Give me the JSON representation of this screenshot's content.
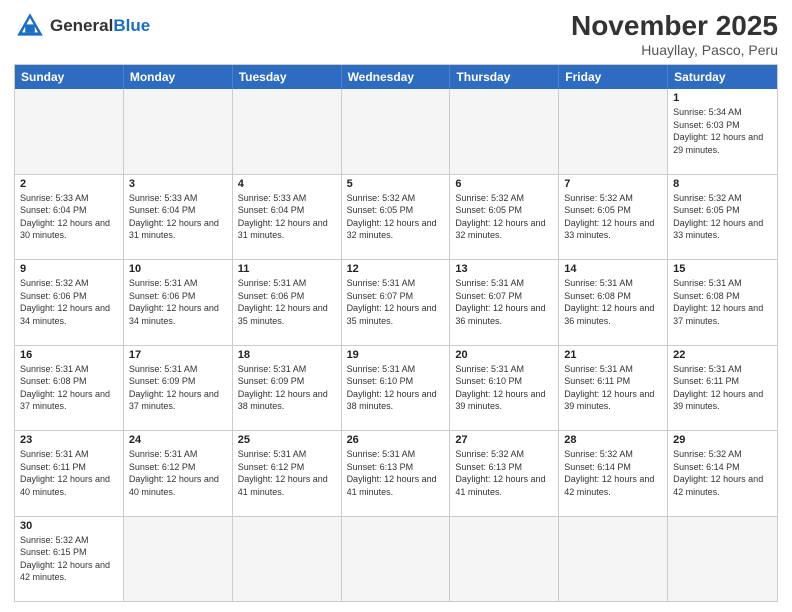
{
  "logo": {
    "text_general": "General",
    "text_blue": "Blue"
  },
  "header": {
    "month": "November 2025",
    "location": "Huayllay, Pasco, Peru"
  },
  "days_of_week": [
    "Sunday",
    "Monday",
    "Tuesday",
    "Wednesday",
    "Thursday",
    "Friday",
    "Saturday"
  ],
  "weeks": [
    [
      {
        "day": "",
        "empty": true
      },
      {
        "day": "",
        "empty": true
      },
      {
        "day": "",
        "empty": true
      },
      {
        "day": "",
        "empty": true
      },
      {
        "day": "",
        "empty": true
      },
      {
        "day": "",
        "empty": true
      },
      {
        "day": "1",
        "sunrise": "5:34 AM",
        "sunset": "6:03 PM",
        "daylight": "12 hours and 29 minutes."
      }
    ],
    [
      {
        "day": "2",
        "sunrise": "5:33 AM",
        "sunset": "6:04 PM",
        "daylight": "12 hours and 30 minutes."
      },
      {
        "day": "3",
        "sunrise": "5:33 AM",
        "sunset": "6:04 PM",
        "daylight": "12 hours and 31 minutes."
      },
      {
        "day": "4",
        "sunrise": "5:33 AM",
        "sunset": "6:04 PM",
        "daylight": "12 hours and 31 minutes."
      },
      {
        "day": "5",
        "sunrise": "5:32 AM",
        "sunset": "6:05 PM",
        "daylight": "12 hours and 32 minutes."
      },
      {
        "day": "6",
        "sunrise": "5:32 AM",
        "sunset": "6:05 PM",
        "daylight": "12 hours and 32 minutes."
      },
      {
        "day": "7",
        "sunrise": "5:32 AM",
        "sunset": "6:05 PM",
        "daylight": "12 hours and 33 minutes."
      },
      {
        "day": "8",
        "sunrise": "5:32 AM",
        "sunset": "6:05 PM",
        "daylight": "12 hours and 33 minutes."
      }
    ],
    [
      {
        "day": "9",
        "sunrise": "5:32 AM",
        "sunset": "6:06 PM",
        "daylight": "12 hours and 34 minutes."
      },
      {
        "day": "10",
        "sunrise": "5:31 AM",
        "sunset": "6:06 PM",
        "daylight": "12 hours and 34 minutes."
      },
      {
        "day": "11",
        "sunrise": "5:31 AM",
        "sunset": "6:06 PM",
        "daylight": "12 hours and 35 minutes."
      },
      {
        "day": "12",
        "sunrise": "5:31 AM",
        "sunset": "6:07 PM",
        "daylight": "12 hours and 35 minutes."
      },
      {
        "day": "13",
        "sunrise": "5:31 AM",
        "sunset": "6:07 PM",
        "daylight": "12 hours and 36 minutes."
      },
      {
        "day": "14",
        "sunrise": "5:31 AM",
        "sunset": "6:08 PM",
        "daylight": "12 hours and 36 minutes."
      },
      {
        "day": "15",
        "sunrise": "5:31 AM",
        "sunset": "6:08 PM",
        "daylight": "12 hours and 37 minutes."
      }
    ],
    [
      {
        "day": "16",
        "sunrise": "5:31 AM",
        "sunset": "6:08 PM",
        "daylight": "12 hours and 37 minutes."
      },
      {
        "day": "17",
        "sunrise": "5:31 AM",
        "sunset": "6:09 PM",
        "daylight": "12 hours and 37 minutes."
      },
      {
        "day": "18",
        "sunrise": "5:31 AM",
        "sunset": "6:09 PM",
        "daylight": "12 hours and 38 minutes."
      },
      {
        "day": "19",
        "sunrise": "5:31 AM",
        "sunset": "6:10 PM",
        "daylight": "12 hours and 38 minutes."
      },
      {
        "day": "20",
        "sunrise": "5:31 AM",
        "sunset": "6:10 PM",
        "daylight": "12 hours and 39 minutes."
      },
      {
        "day": "21",
        "sunrise": "5:31 AM",
        "sunset": "6:11 PM",
        "daylight": "12 hours and 39 minutes."
      },
      {
        "day": "22",
        "sunrise": "5:31 AM",
        "sunset": "6:11 PM",
        "daylight": "12 hours and 39 minutes."
      }
    ],
    [
      {
        "day": "23",
        "sunrise": "5:31 AM",
        "sunset": "6:11 PM",
        "daylight": "12 hours and 40 minutes."
      },
      {
        "day": "24",
        "sunrise": "5:31 AM",
        "sunset": "6:12 PM",
        "daylight": "12 hours and 40 minutes."
      },
      {
        "day": "25",
        "sunrise": "5:31 AM",
        "sunset": "6:12 PM",
        "daylight": "12 hours and 41 minutes."
      },
      {
        "day": "26",
        "sunrise": "5:31 AM",
        "sunset": "6:13 PM",
        "daylight": "12 hours and 41 minutes."
      },
      {
        "day": "27",
        "sunrise": "5:32 AM",
        "sunset": "6:13 PM",
        "daylight": "12 hours and 41 minutes."
      },
      {
        "day": "28",
        "sunrise": "5:32 AM",
        "sunset": "6:14 PM",
        "daylight": "12 hours and 42 minutes."
      },
      {
        "day": "29",
        "sunrise": "5:32 AM",
        "sunset": "6:14 PM",
        "daylight": "12 hours and 42 minutes."
      }
    ],
    [
      {
        "day": "30",
        "sunrise": "5:32 AM",
        "sunset": "6:15 PM",
        "daylight": "12 hours and 42 minutes."
      },
      {
        "day": "",
        "empty": true
      },
      {
        "day": "",
        "empty": true
      },
      {
        "day": "",
        "empty": true
      },
      {
        "day": "",
        "empty": true
      },
      {
        "day": "",
        "empty": true
      },
      {
        "day": "",
        "empty": true
      }
    ]
  ]
}
